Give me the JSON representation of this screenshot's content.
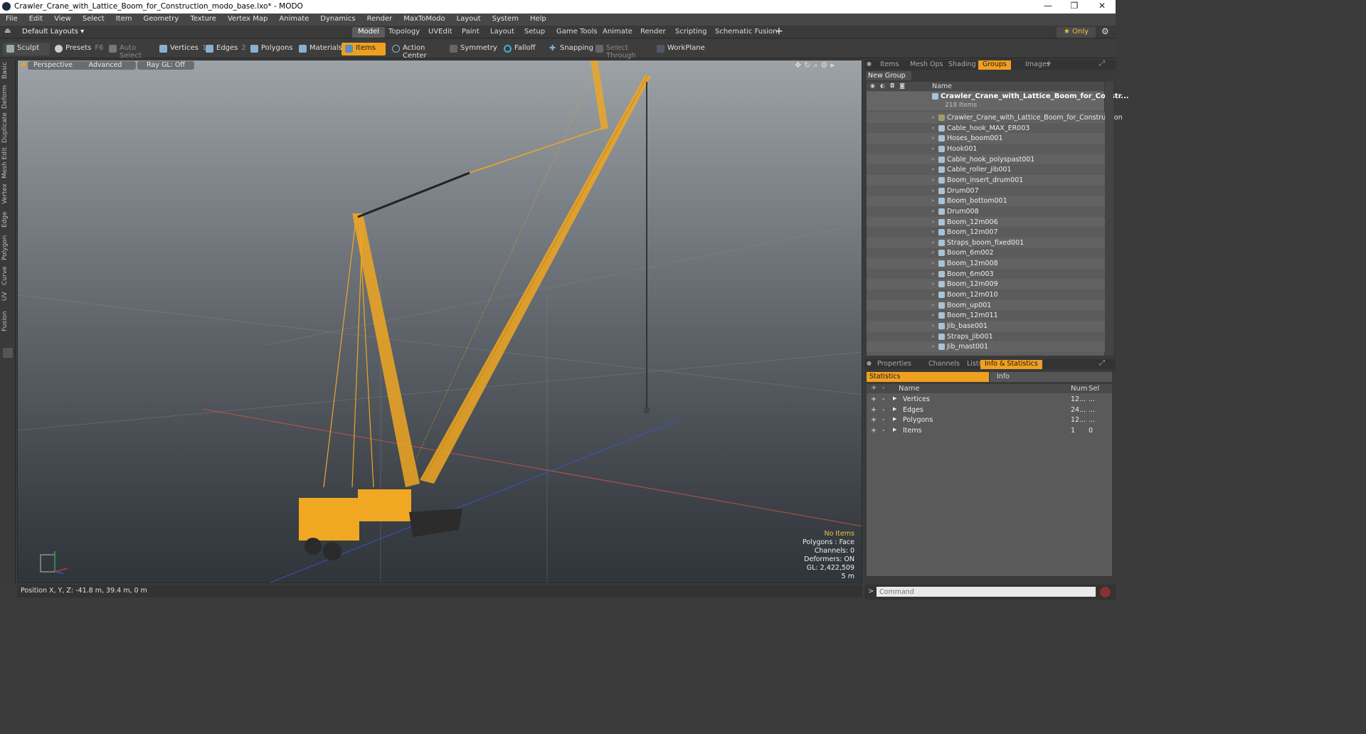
{
  "window": {
    "title": "Crawler_Crane_with_Lattice_Boom_for_Construction_modo_base.lxo* - MODO",
    "minimize": "—",
    "maximize": "❐",
    "close": "✕"
  },
  "menu": [
    "File",
    "Edit",
    "View",
    "Select",
    "Item",
    "Geometry",
    "Texture",
    "Vertex Map",
    "Animate",
    "Dynamics",
    "Render",
    "MaxToModo",
    "Layout",
    "System",
    "Help"
  ],
  "layout": {
    "preset": "Default Layouts ▾",
    "tabs": [
      "Model",
      "Topology",
      "UVEdit",
      "Paint",
      "Layout",
      "Setup",
      "Game Tools",
      "Animate",
      "Render",
      "Scripting",
      "Schematic Fusion"
    ],
    "active_tab": "Model",
    "add": "+",
    "only": "★ Only",
    "gear": "⚙"
  },
  "toolbar": {
    "sculpt": "Sculpt",
    "presets": "Presets",
    "presets_key": "F6",
    "auto_select": "Auto Select",
    "vertices": "Vertices",
    "vertices_key": "1",
    "edges": "Edges",
    "edges_key": "2",
    "polygons": "Polygons",
    "materials": "Materials",
    "items": "Items",
    "action_center": "Action Center",
    "symmetry": "Symmetry",
    "falloff": "Falloff",
    "snapping": "Snapping",
    "select_through": "Select Through",
    "workplane": "WorkPlane"
  },
  "left_tabs": [
    "Basic",
    "Deform",
    "Duplicate",
    "Mesh Edit",
    "Vertex",
    "Edge",
    "Polygon",
    "Curve",
    "UV",
    "Fusion"
  ],
  "viewport": {
    "perspective": "Perspective",
    "advanced": "Advanced",
    "raygl": "Ray GL: Off",
    "stats": {
      "no_items": "No Items",
      "polygons": "Polygons : Face",
      "channels": "Channels: 0",
      "deformers": "Deformers: ON",
      "gl": "GL: 2,422,509",
      "scale": "5 m"
    },
    "colors": {
      "crane": "#f0a722",
      "x_axis": "#c0504d",
      "z_axis": "#3a55c0"
    }
  },
  "status": {
    "position": "Position X, Y, Z:   -41.8 m, 39.4 m, 0 m"
  },
  "items_panel": {
    "tabs": [
      "Items",
      "Mesh Ops",
      "Shading",
      "Groups",
      "Images"
    ],
    "active_tab": "Groups",
    "new_group": "New Group",
    "name_header": "Name",
    "root": "Crawler_Crane_with_Lattice_Boom_for_Constr...",
    "root_count": "218 Items",
    "items": [
      "Crawler_Crane_with_Lattice_Boom_for_Construction",
      "Cable_hook_MAX_ER003",
      "Hoses_boom001",
      "Hook001",
      "Cable_hook_polyspast001",
      "Cable_roller_jib001",
      "Boom_insert_drum001",
      "Drum007",
      "Boom_bottom001",
      "Drum008",
      "Boom_12m006",
      "Boom_12m007",
      "Straps_boom_fixed001",
      "Boom_6m002",
      "Boom_12m008",
      "Boom_6m003",
      "Boom_12m009",
      "Boom_12m010",
      "Boom_up001",
      "Boom_12m011",
      "Jib_base001",
      "Straps_jib001",
      "Jib_mast001"
    ]
  },
  "stats_panel": {
    "tabs": [
      "Properties",
      "Channels",
      "Lists",
      "Info & Statistics"
    ],
    "active_tab": "Info & Statistics",
    "sub_tabs": [
      "Statistics",
      "Info"
    ],
    "headers": {
      "name": "Name",
      "num": "Num",
      "sel": "Sel"
    },
    "rows": [
      {
        "name": "Vertices",
        "num": "12...",
        "sel": "..."
      },
      {
        "name": "Edges",
        "num": "24...",
        "sel": "..."
      },
      {
        "name": "Polygons",
        "num": "12...",
        "sel": "..."
      },
      {
        "name": "Items",
        "num": "1",
        "sel": "0"
      }
    ]
  },
  "command": {
    "placeholder": "Command",
    "prompt": ">"
  }
}
